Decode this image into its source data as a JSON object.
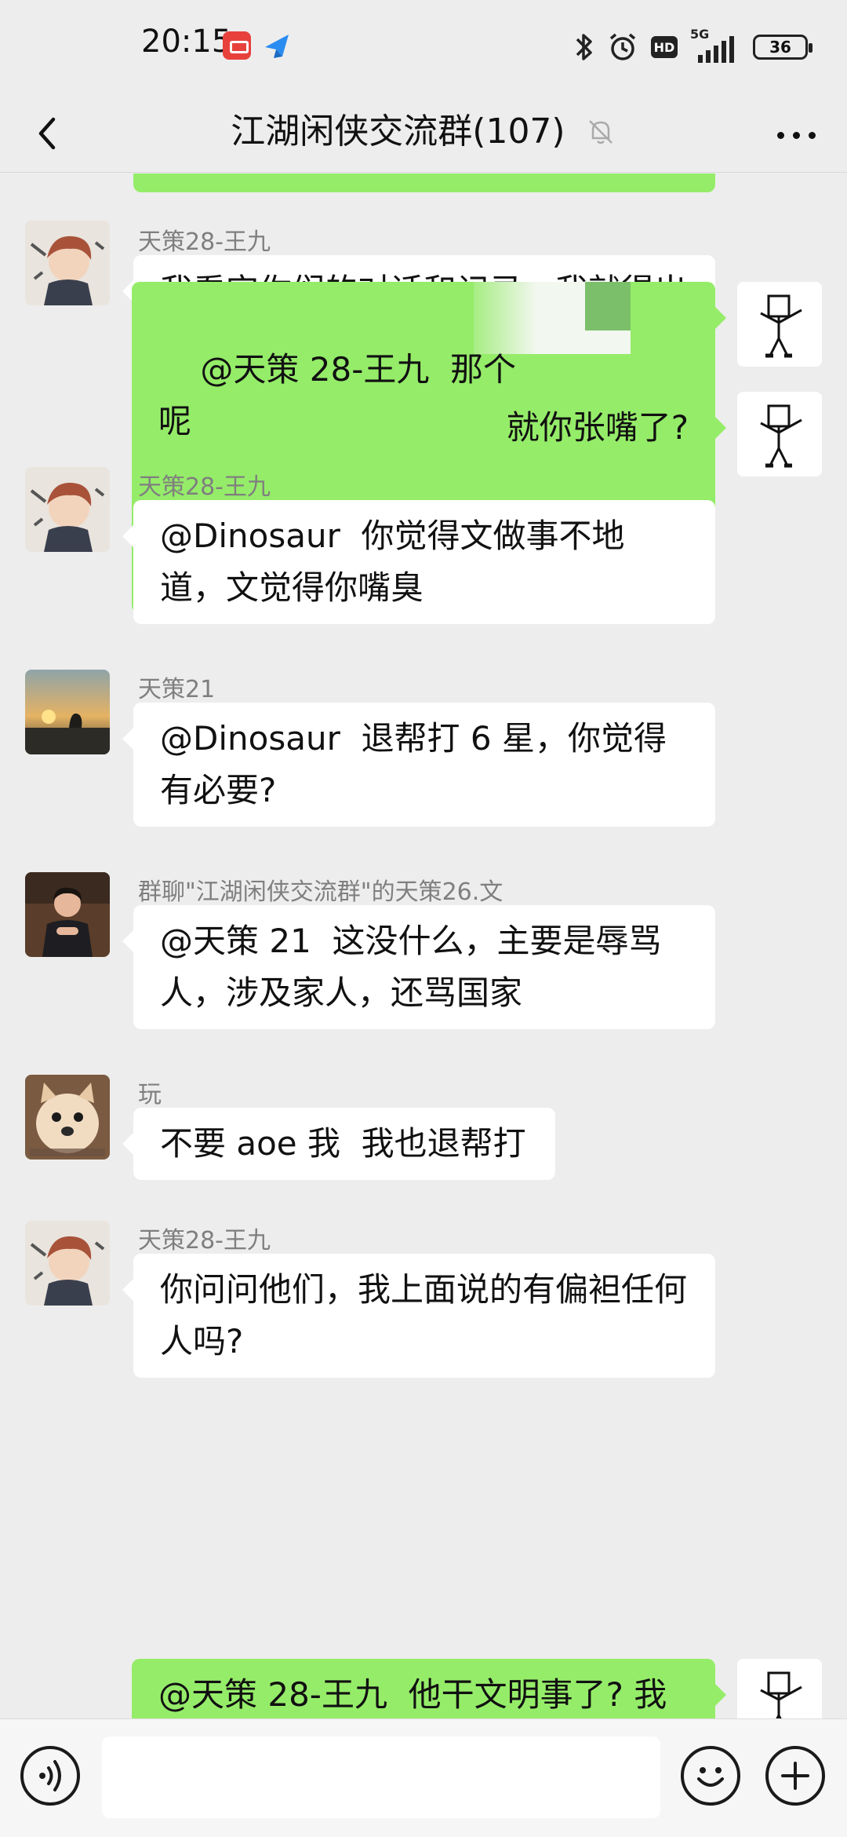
{
  "status_bar": {
    "time": "20:15",
    "network": "5G",
    "hd": "HD",
    "battery": "36"
  },
  "header": {
    "title": "江湖闲侠交流群(107)"
  },
  "messages": [
    {
      "side": "in",
      "sender": "天策28-王九",
      "avatar": "avatar-anime-boy",
      "text": "我看完你们的对话和记录，我就得出一个结论"
    },
    {
      "side": "out",
      "avatar": "avatar-doodle-man",
      "text": "@天策 28-王九  那个\n呢"
    },
    {
      "side": "out",
      "avatar": "avatar-doodle-man",
      "text": "就你张嘴了?"
    },
    {
      "side": "in",
      "sender": "天策28-王九",
      "avatar": "avatar-anime-boy",
      "text": "@Dinosaur  你觉得文做事不地道，文觉得你嘴臭"
    },
    {
      "side": "in",
      "sender": "天策21",
      "avatar": "avatar-sunset",
      "text": "@Dinosaur  退帮打 6 星，你觉得有必要?"
    },
    {
      "side": "in",
      "sender": "群聊\"江湖闲侠交流群\"的天策26.文",
      "avatar": "avatar-man-photo",
      "text": "@天策 21  这没什么，主要是辱骂人，涉及家人，还骂国家"
    },
    {
      "side": "in",
      "sender": "玩",
      "avatar": "avatar-shiba-dog",
      "text": "不要 aoe 我  我也退帮打"
    },
    {
      "side": "in",
      "sender": "天策28-王九",
      "avatar": "avatar-anime-boy",
      "text": "你问问他们，我上面说的有偏袒任何人吗?"
    },
    {
      "side": "out",
      "avatar": "avatar-doodle-man",
      "text": "@天策 28-王九  他干文明事了? 我"
    }
  ],
  "input": {
    "placeholder": ""
  },
  "colors": {
    "background": "#ededed",
    "outgoing_bubble": "#95ec69",
    "incoming_bubble": "#ffffff",
    "sender_text": "#7f7f7f"
  },
  "icons": [
    "back-arrow-icon",
    "mute-bell-icon",
    "more-dots-icon",
    "voice-icon",
    "emoji-icon",
    "plus-icon",
    "bluetooth-icon",
    "alarm-icon"
  ]
}
